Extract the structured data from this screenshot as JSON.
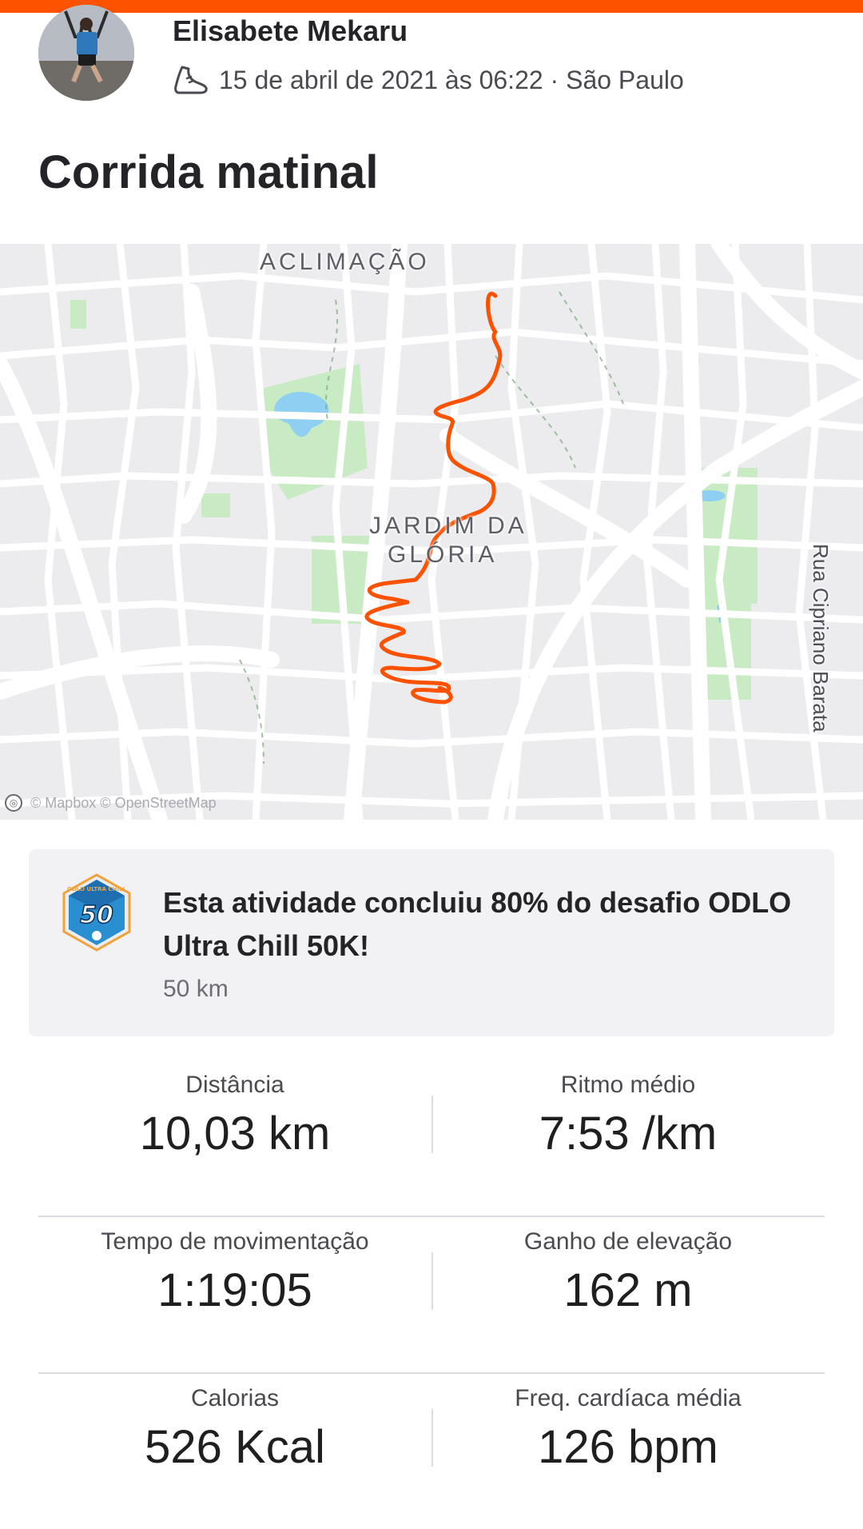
{
  "athlete": {
    "name": "Elisabete Mekaru",
    "date_location": "15 de abril de 2021 às 06:22 · São Paulo",
    "activity_icon": "shoe-icon"
  },
  "activity": {
    "title": "Corrida matinal"
  },
  "map": {
    "neighborhoods": [
      "ACLIMAÇÃO",
      "JARDIM DA",
      "GLÓRIA"
    ],
    "street": "Rua Cipriano Barata",
    "attribution": "© Mapbox © OpenStreetMap",
    "route_color": "#fc5200"
  },
  "challenge": {
    "text": "Esta atividade concluiu 80% do desafio ODLO Ultra Chill 50K!",
    "subtext": "50 km",
    "badge_number": "50",
    "badge_text": "ODLO ULTRA CHILL",
    "progress_percent": 80
  },
  "stats": [
    {
      "label": "Distância",
      "value": "10,03 km"
    },
    {
      "label": "Ritmo médio",
      "value": "7:53 /km"
    },
    {
      "label": "Tempo de movimentação",
      "value": "1:19:05"
    },
    {
      "label": "Ganho de elevação",
      "value": "162 m"
    },
    {
      "label": "Calorias",
      "value": "526 Kcal"
    },
    {
      "label": "Freq. cardíaca média",
      "value": "126 bpm"
    }
  ],
  "colors": {
    "accent": "#fc5200",
    "park": "#c9ebc4",
    "water": "#8fd0f2"
  }
}
